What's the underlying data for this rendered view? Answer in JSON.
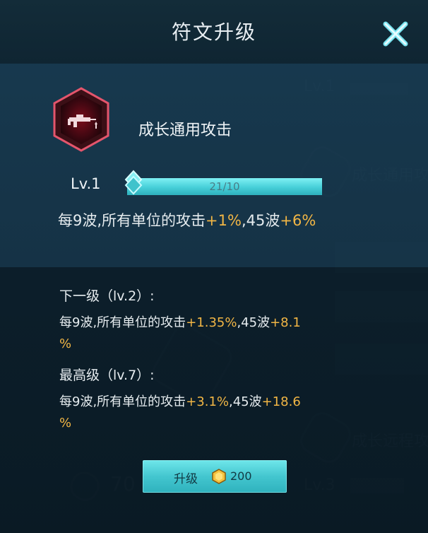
{
  "dialog": {
    "title": "符文升级",
    "close_icon": "close-x-icon"
  },
  "rune": {
    "icon": "rifle-rune-icon",
    "name": "成长通用攻击",
    "level": "Lv.1",
    "progress_text": "21/10",
    "progress_fraction": 1.0,
    "current_effect": {
      "prefix": "每9波,所有单位的攻击",
      "value1": "+1%",
      "mid": ",45波",
      "value2": "+6%"
    }
  },
  "next_level": {
    "heading": "下一级（lv.2）:",
    "prefix": "每9波,所有单位的攻击",
    "value1": "+1.35%",
    "mid": ",45波",
    "value2_line1": "+8.1",
    "value2_line2": "%"
  },
  "max_level": {
    "heading": "最高级（lv.7）:",
    "prefix": "每9波,所有单位的攻击",
    "value1": "+3.1%",
    "mid": ",45波",
    "value2_line1": "+18.6",
    "value2_line2": "%"
  },
  "upgrade_button": {
    "label": "升级",
    "cost_icon": "gold-coin-icon",
    "cost": "200"
  },
  "colors": {
    "highlight": "#f2b645",
    "button": "#43c6cf",
    "progress": "#46cfd8"
  }
}
